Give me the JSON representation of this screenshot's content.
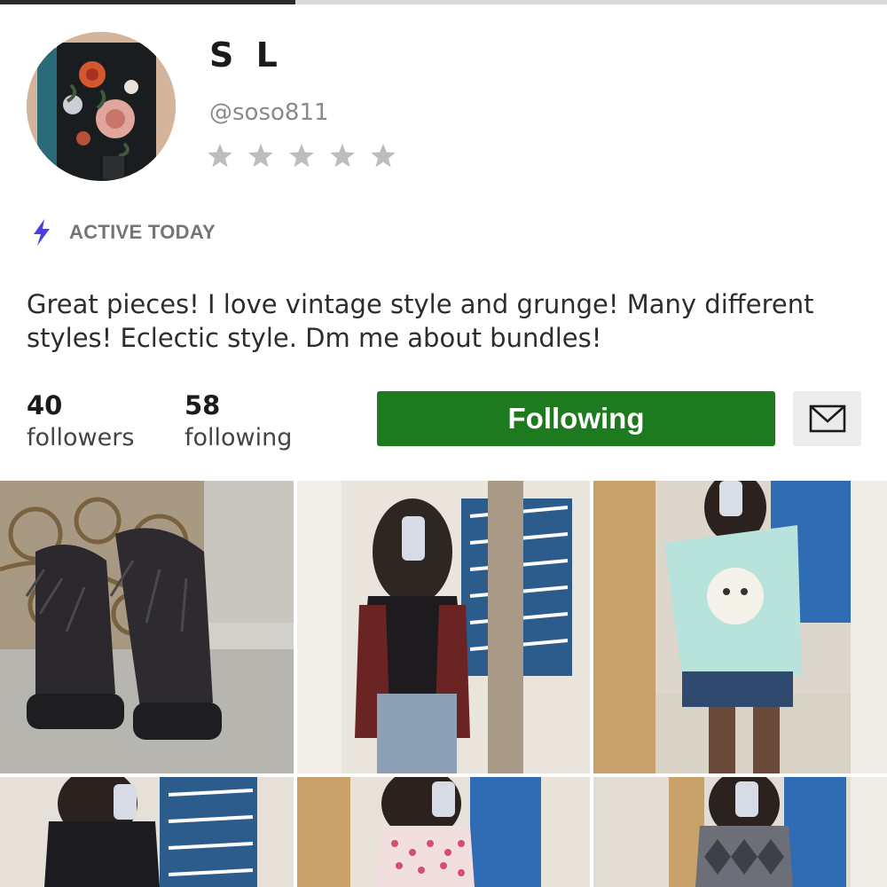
{
  "top_progress": {
    "fraction": 0.333
  },
  "profile": {
    "display_name": "S L",
    "username": "@soso811",
    "rating": {
      "filled_stars": 0,
      "max_stars": 5,
      "star_color": "#bdbdbd"
    },
    "activity": {
      "text": "ACTIVE TODAY",
      "icon": "lightning-bolt-icon",
      "icon_color": "#4a3fd6"
    },
    "bio": "Great pieces! I love vintage style and grunge! Many different styles! Eclectic style. Dm me about bundles!"
  },
  "stats": {
    "followers": {
      "count": "40",
      "label": "followers"
    },
    "following": {
      "count": "58",
      "label": "following"
    }
  },
  "actions": {
    "follow_label": "Following",
    "follow_color": "#1e7a1e",
    "message_icon": "envelope-icon"
  },
  "listings": [
    {
      "subject": "fringed black boots on pavement"
    },
    {
      "subject": "mirror selfie, burgundy fringe vest"
    },
    {
      "subject": "mirror selfie, light blue graphic tee"
    },
    {
      "subject": "mirror selfie, black top"
    },
    {
      "subject": "mirror selfie, pink polka dot top"
    },
    {
      "subject": "mirror selfie, argyle top"
    }
  ]
}
